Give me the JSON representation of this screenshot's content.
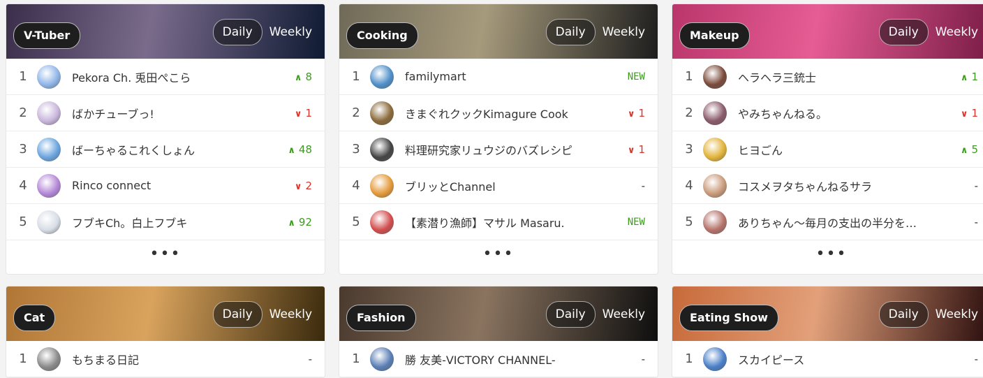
{
  "cards": [
    {
      "category": "V-Tuber",
      "daily_label": "Daily",
      "weekly_label": "Weekly",
      "header_colors": [
        "#3a2e4b",
        "#7a6b8b",
        "#0f1a33"
      ],
      "more_label": "•••",
      "rows": [
        {
          "rank": "1",
          "name": "Pekora Ch. 兎田ぺこら",
          "change": "8",
          "trend": "up",
          "avatar_color": "#8fb5e8"
        },
        {
          "rank": "2",
          "name": "ばかチューブっ!",
          "change": "1",
          "trend": "down",
          "avatar_color": "#c9b6dc"
        },
        {
          "rank": "3",
          "name": "ばーちゃるこれくしょん",
          "change": "48",
          "trend": "up",
          "avatar_color": "#6aa5df"
        },
        {
          "rank": "4",
          "name": "Rinco connect",
          "change": "2",
          "trend": "down",
          "avatar_color": "#b487d8"
        },
        {
          "rank": "5",
          "name": "フブキCh。白上フブキ",
          "change": "92",
          "trend": "up",
          "avatar_color": "#d7dde6"
        }
      ]
    },
    {
      "category": "Cooking",
      "daily_label": "Daily",
      "weekly_label": "Weekly",
      "header_colors": [
        "#6f6a58",
        "#a69a7c",
        "#1d1d1d"
      ],
      "more_label": "•••",
      "rows": [
        {
          "rank": "1",
          "name": "familymart",
          "change": "NEW",
          "trend": "new",
          "avatar_color": "#4f8fc9"
        },
        {
          "rank": "2",
          "name": "きまぐれクックKimagure Cook",
          "change": "1",
          "trend": "down",
          "avatar_color": "#8a6a3a"
        },
        {
          "rank": "3",
          "name": "料理研究家リュウジのバズレシピ",
          "change": "1",
          "trend": "down",
          "avatar_color": "#444444"
        },
        {
          "rank": "4",
          "name": "ブリッとChannel",
          "change": "-",
          "trend": "flat",
          "avatar_color": "#e49a3a"
        },
        {
          "rank": "5",
          "name": "【素潜り漁師】マサル Masaru.",
          "change": "NEW",
          "trend": "new",
          "avatar_color": "#d24d4d"
        }
      ]
    },
    {
      "category": "Makeup",
      "daily_label": "Daily",
      "weekly_label": "Weekly",
      "header_colors": [
        "#b9366b",
        "#e65c94",
        "#7a1c46"
      ],
      "more_label": "•••",
      "rows": [
        {
          "rank": "1",
          "name": "ヘラヘラ三銃士",
          "change": "1",
          "trend": "up",
          "avatar_color": "#7a4a3a"
        },
        {
          "rank": "2",
          "name": "やみちゃんねる。",
          "change": "1",
          "trend": "down",
          "avatar_color": "#8a5a6a"
        },
        {
          "rank": "3",
          "name": "ヒヨごん",
          "change": "5",
          "trend": "up",
          "avatar_color": "#e2b33a"
        },
        {
          "rank": "4",
          "name": "コスメヲタちゃんねるサラ",
          "change": "-",
          "trend": "flat",
          "avatar_color": "#c99a7a"
        },
        {
          "rank": "5",
          "name": "ありちゃん〜毎月の支出の半分を…",
          "change": "-",
          "trend": "flat",
          "avatar_color": "#b5726a"
        }
      ]
    },
    {
      "category": "Cat",
      "daily_label": "Daily",
      "weekly_label": "Weekly",
      "header_colors": [
        "#b07636",
        "#d9a35d",
        "#3a2a0d"
      ],
      "rows": [
        {
          "rank": "1",
          "name": "もちまる日記",
          "change": "-",
          "trend": "flat",
          "avatar_color": "#8a8a8a"
        }
      ]
    },
    {
      "category": "Fashion",
      "daily_label": "Daily",
      "weekly_label": "Weekly",
      "header_colors": [
        "#4a3a2e",
        "#8a7460",
        "#0e0e0e"
      ],
      "rows": [
        {
          "rank": "1",
          "name": "勝 友美-VICTORY CHANNEL-",
          "change": "-",
          "trend": "flat",
          "avatar_color": "#5a7fb5"
        }
      ]
    },
    {
      "category": "Eating Show",
      "daily_label": "Daily",
      "weekly_label": "Weekly",
      "header_colors": [
        "#c86a3a",
        "#e2a07a",
        "#2a0d0d"
      ],
      "rows": [
        {
          "rank": "1",
          "name": "スカイピース",
          "change": "-",
          "trend": "flat",
          "avatar_color": "#4a7fc9"
        }
      ]
    }
  ]
}
